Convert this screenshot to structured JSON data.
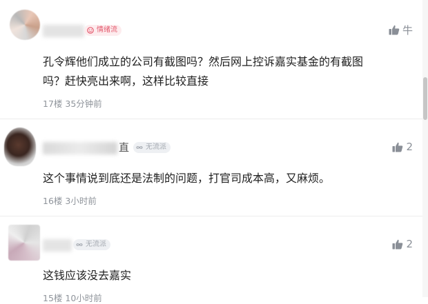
{
  "comments": [
    {
      "badge": "情绪流",
      "badge_icon": "emotion-icon",
      "likes": "牛",
      "text_line1": "孔令辉他们成立的公司有截图吗？然后网上控诉嘉实基金的有截图",
      "text_line2": "吗？赶快亮出来啊，这样比较直接",
      "floor": "17楼",
      "time": "35分钟前"
    },
    {
      "badge": "无流派",
      "badge_icon": "infinity-icon",
      "name_partial": "直",
      "likes": "2",
      "text_line1": "这个事情说到底还是法制的问题，打官司成本高，又麻烦。",
      "floor": "16楼",
      "time": "3小时前"
    },
    {
      "badge": "无流派",
      "badge_icon": "infinity-icon",
      "likes": "2",
      "text_line1": "这钱应该没去嘉实",
      "floor": "15楼",
      "time": "10小时前"
    }
  ],
  "colors": {
    "badge_pink_text": "#e45a6e",
    "badge_pink_bg": "#fdecee",
    "badge_gray_text": "#a4a9b0",
    "meta_text": "#8f949b",
    "like_icon": "#8a8f97"
  }
}
